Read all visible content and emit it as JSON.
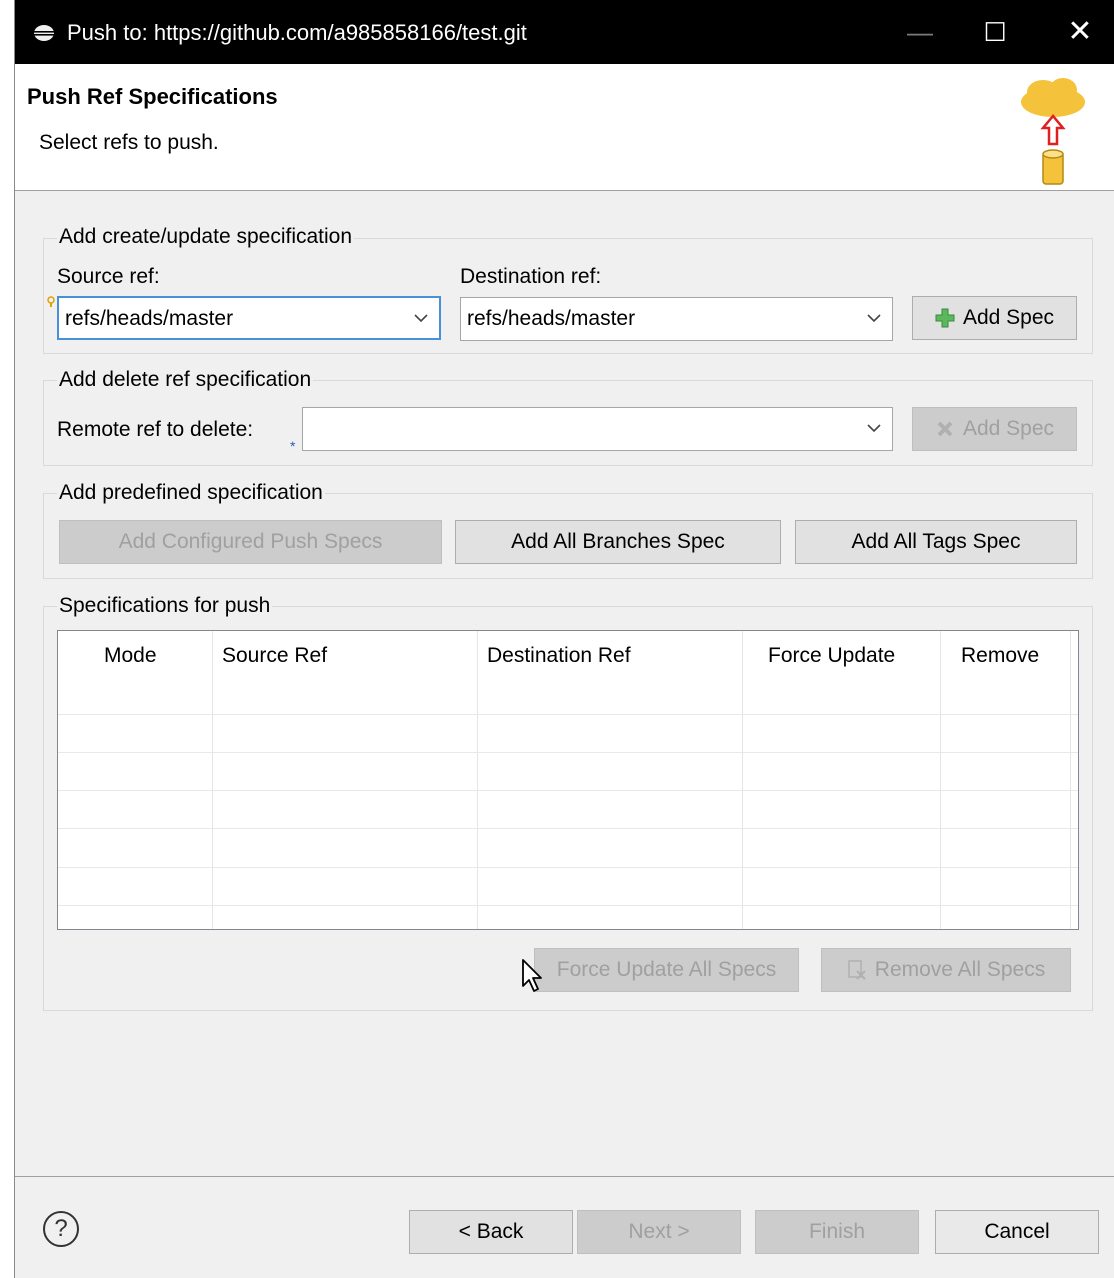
{
  "window": {
    "title": "Push to: https://github.com/a985858166/test.git",
    "minimize": "—",
    "maximize": "☐",
    "close": "✕"
  },
  "header": {
    "title": "Push Ref Specifications",
    "description": "Select refs to push.",
    "icon": "cloud-push-icon"
  },
  "create_update": {
    "group_label": "Add create/update specification",
    "source_label": "Source ref:",
    "source_value": "refs/heads/master",
    "destination_label": "Destination ref:",
    "destination_value": "refs/heads/master",
    "add_spec_label": "Add Spec"
  },
  "delete_ref": {
    "group_label": "Add delete ref specification",
    "remote_label": "Remote ref to delete:",
    "remote_value": "",
    "add_spec_label": "Add Spec"
  },
  "predefined": {
    "group_label": "Add predefined specification",
    "configured_label": "Add Configured Push Specs",
    "all_branches_label": "Add All Branches Spec",
    "all_tags_label": "Add All Tags Spec"
  },
  "specs": {
    "group_label": "Specifications for push",
    "columns": [
      "Mode",
      "Source Ref",
      "Destination Ref",
      "Force Update",
      "Remove"
    ],
    "rows": [],
    "force_update_all_label": "Force Update All Specs",
    "remove_all_label": "Remove All Specs"
  },
  "footer": {
    "help": "?",
    "back_label": "< Back",
    "next_label": "Next >",
    "finish_label": "Finish",
    "cancel_label": "Cancel"
  },
  "colors": {
    "title_bar": "#000000",
    "focus_border": "#4a90d9",
    "add_icon": "#5cb85c",
    "cloud": "#f5c33b",
    "arrow": "#e02020"
  }
}
